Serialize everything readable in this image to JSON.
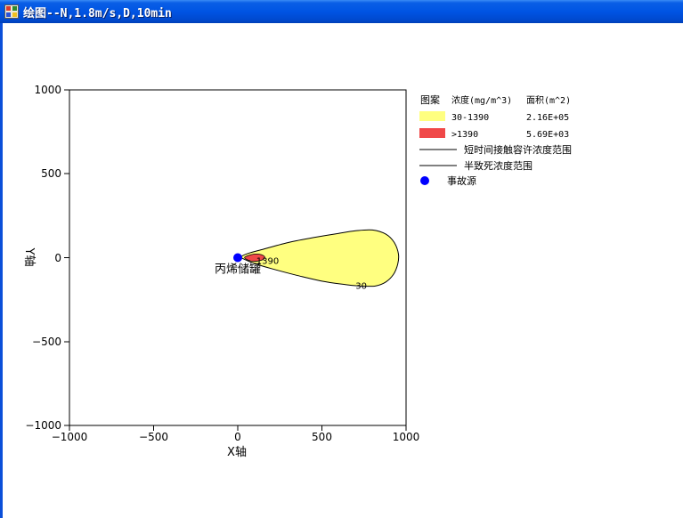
{
  "window": {
    "title": "绘图--N,1.8m/s,D,10min"
  },
  "colors": {
    "titlebar": "#0054e3",
    "zone_low": "#ffff80",
    "zone_high": "#f04848",
    "source_marker": "#0000ff"
  },
  "chart_data": {
    "type": "area",
    "xlabel": "X轴",
    "ylabel": "Y轴",
    "xlim": [
      -1000,
      1000
    ],
    "ylim": [
      -1000,
      1000
    ],
    "xticks": [
      "−1000",
      "−500",
      "0",
      "500",
      "1000"
    ],
    "yticks": [
      "1000",
      "500",
      "0",
      "−500",
      "−1000"
    ],
    "grid": false,
    "source": {
      "name": "丙烯储罐",
      "x": 0,
      "y": 0
    },
    "contours": [
      {
        "name": "30-1390",
        "label": "30",
        "outline": [
          [
            20,
            5
          ],
          [
            60,
            25
          ],
          [
            150,
            50
          ],
          [
            300,
            90
          ],
          [
            450,
            120
          ],
          [
            600,
            145
          ],
          [
            700,
            160
          ],
          [
            800,
            165
          ],
          [
            880,
            140
          ],
          [
            930,
            90
          ],
          [
            955,
            20
          ],
          [
            950,
            -40
          ],
          [
            925,
            -100
          ],
          [
            880,
            -145
          ],
          [
            820,
            -168
          ],
          [
            750,
            -170
          ],
          [
            650,
            -162
          ],
          [
            500,
            -140
          ],
          [
            350,
            -105
          ],
          [
            200,
            -65
          ],
          [
            100,
            -35
          ],
          [
            40,
            -10
          ]
        ]
      },
      {
        "name": ">1390",
        "label": "1390",
        "outline": [
          [
            40,
            0
          ],
          [
            55,
            10
          ],
          [
            80,
            18
          ],
          [
            110,
            22
          ],
          [
            140,
            18
          ],
          [
            158,
            8
          ],
          [
            160,
            -2
          ],
          [
            150,
            -12
          ],
          [
            120,
            -20
          ],
          [
            90,
            -22
          ],
          [
            60,
            -14
          ]
        ]
      }
    ],
    "legend": {
      "position": "right",
      "header": {
        "pattern": "图案",
        "concentration": "浓度(mg/m^3)",
        "area": "面积(m^2)"
      },
      "entries": [
        {
          "concentration": "30-1390",
          "area": "2.16E+05"
        },
        {
          "concentration": ">1390",
          "area": "5.69E+03"
        }
      ],
      "lines": [
        {
          "label": "短时间接触容许浓度范围"
        },
        {
          "label": "半致死浓度范围"
        }
      ],
      "marker_label": "事故源"
    }
  }
}
